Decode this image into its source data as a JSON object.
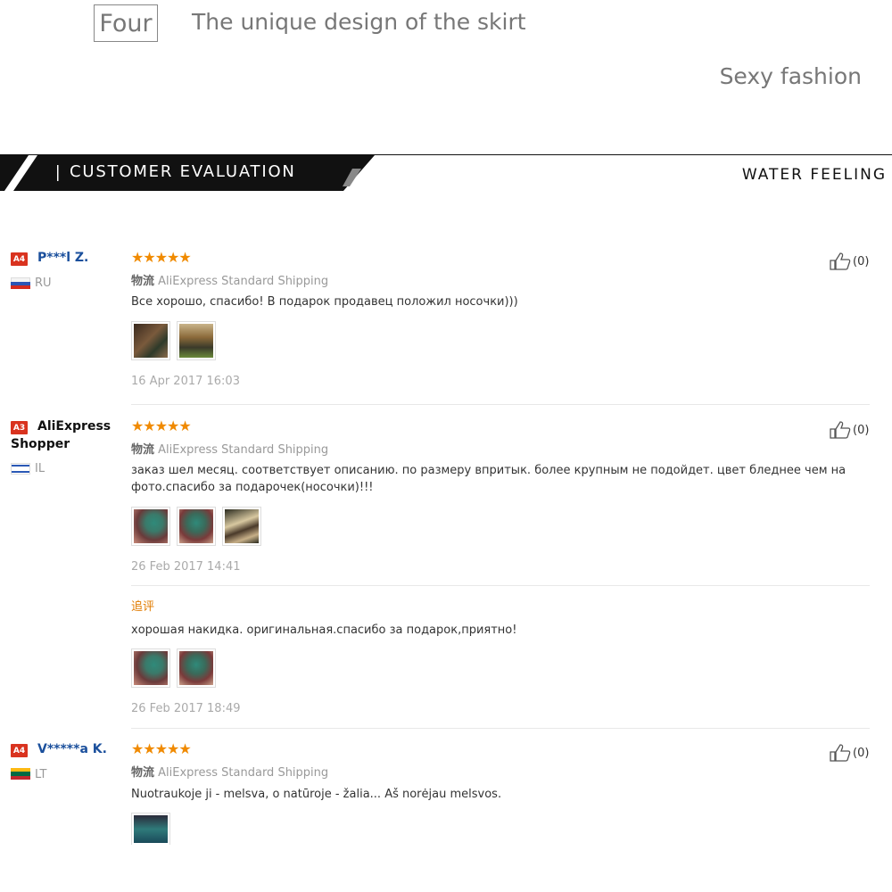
{
  "header": {
    "number_label": "Four",
    "headline": "The unique design of the skirt",
    "subline": "Sexy fashion"
  },
  "banner": {
    "title": "CUSTOMER EVALUATION",
    "right_label": "WATER FEELING"
  },
  "shipping_prefix": "物流",
  "followup_label": "追评",
  "reviews": [
    {
      "level": "A4",
      "user": "P***l Z.",
      "country": "RU",
      "shipping": "AliExpress Standard Shipping",
      "text": "Все хорошо, спасибо! В подарок продавец положил носочки)))",
      "date": "16 Apr 2017 16:03",
      "likes": "(0)",
      "rating": 5
    },
    {
      "level": "A3",
      "user_line1": "AliExpress",
      "user_line2": "Shopper",
      "country": "IL",
      "shipping": "AliExpress Standard Shipping",
      "text_line1": "заказ шел месяц. соответствует описанию. по размеру впритык. более крупным не подойдет. цвет бледнее чем на",
      "text_line2": "фото.спасибо за подарочек(носочки)!!!",
      "date": "26 Feb 2017 14:41",
      "followup_text": "хорошая накидка. оригинальная.спасибо за подарок,приятно!",
      "followup_date": "26 Feb 2017 18:49",
      "likes": "(0)",
      "rating": 5
    },
    {
      "level": "A4",
      "user": "V*****a K.",
      "country": "LT",
      "shipping": "AliExpress Standard Shipping",
      "text": "Nuotraukoje ji - melsva, o natūroje - žalia... Aš norėjau melsvos.",
      "likes": "(0)",
      "rating": 5
    }
  ],
  "stars_glyph": "★★★★★"
}
